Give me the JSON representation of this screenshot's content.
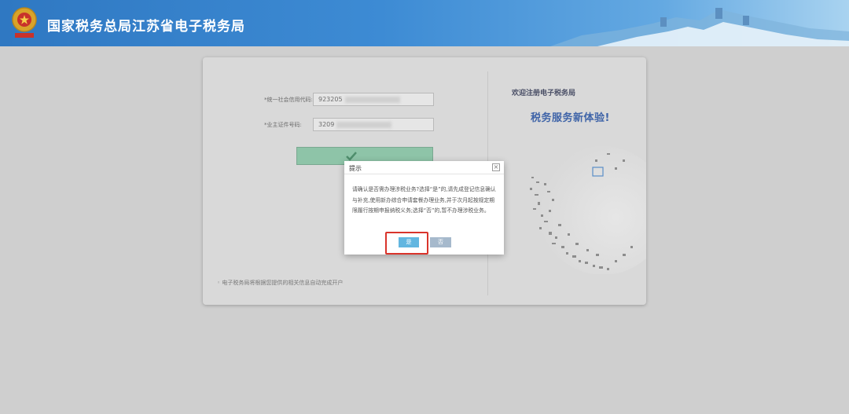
{
  "header": {
    "title": "国家税务总局江苏省电子税务局"
  },
  "form": {
    "credit_code_label": "*统一社会信用代码:",
    "credit_code_value": "923205",
    "id_number_label": "*业主证件号码:",
    "id_number_value": "3209",
    "footnote": "电子税务局将根据您提供的相关信息自动完成开户"
  },
  "promo": {
    "welcome": "欢迎注册电子税务局",
    "slogan": "税务服务新体验!"
  },
  "dialog": {
    "title": "提示",
    "close_symbol": "×",
    "message": "请确认是否需办理涉税业务?选择“是”的,请先成登记信息确认与补充,使用新办综合申请套餐办理业务,并于次月起按规定期限履行按期申报纳税义务;选择“否”的,暂不办理涉税业务。",
    "yes_label": "是",
    "no_label": "否"
  },
  "colors": {
    "header_blue": "#2f78c2",
    "yes_button": "#62b6e0",
    "no_button": "#a6b9cc",
    "highlight_red": "#d9342b"
  }
}
